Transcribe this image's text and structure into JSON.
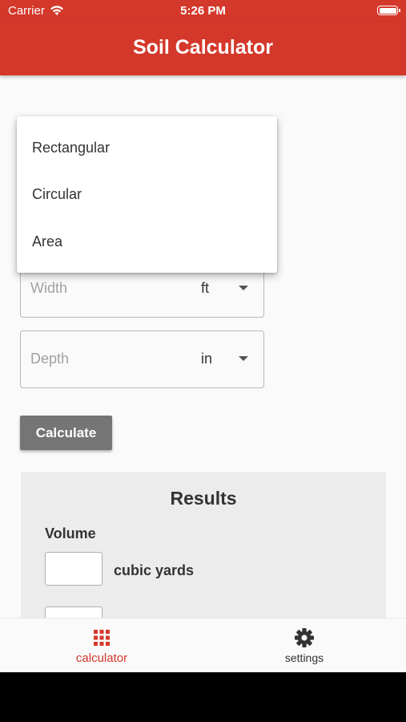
{
  "status_bar": {
    "carrier": "Carrier",
    "time": "5:26 PM"
  },
  "app_bar": {
    "title": "Soil Calculator"
  },
  "form": {
    "width": {
      "placeholder": "Width",
      "unit": "ft"
    },
    "depth": {
      "placeholder": "Depth",
      "unit": "in"
    },
    "calculate_label": "Calculate"
  },
  "dropdown": {
    "items": [
      {
        "label": "Rectangular"
      },
      {
        "label": "Circular"
      },
      {
        "label": "Area"
      }
    ]
  },
  "results": {
    "title": "Results",
    "volume_label": "Volume",
    "unit_1": "cubic yards"
  },
  "bottom_nav": {
    "items": [
      {
        "label": "calculator",
        "icon": "grid-icon",
        "active": true
      },
      {
        "label": "settings",
        "icon": "gear-icon",
        "active": false
      }
    ]
  },
  "colors": {
    "primary": "#d4382b",
    "button": "#757575",
    "results_bg": "#ececec"
  }
}
